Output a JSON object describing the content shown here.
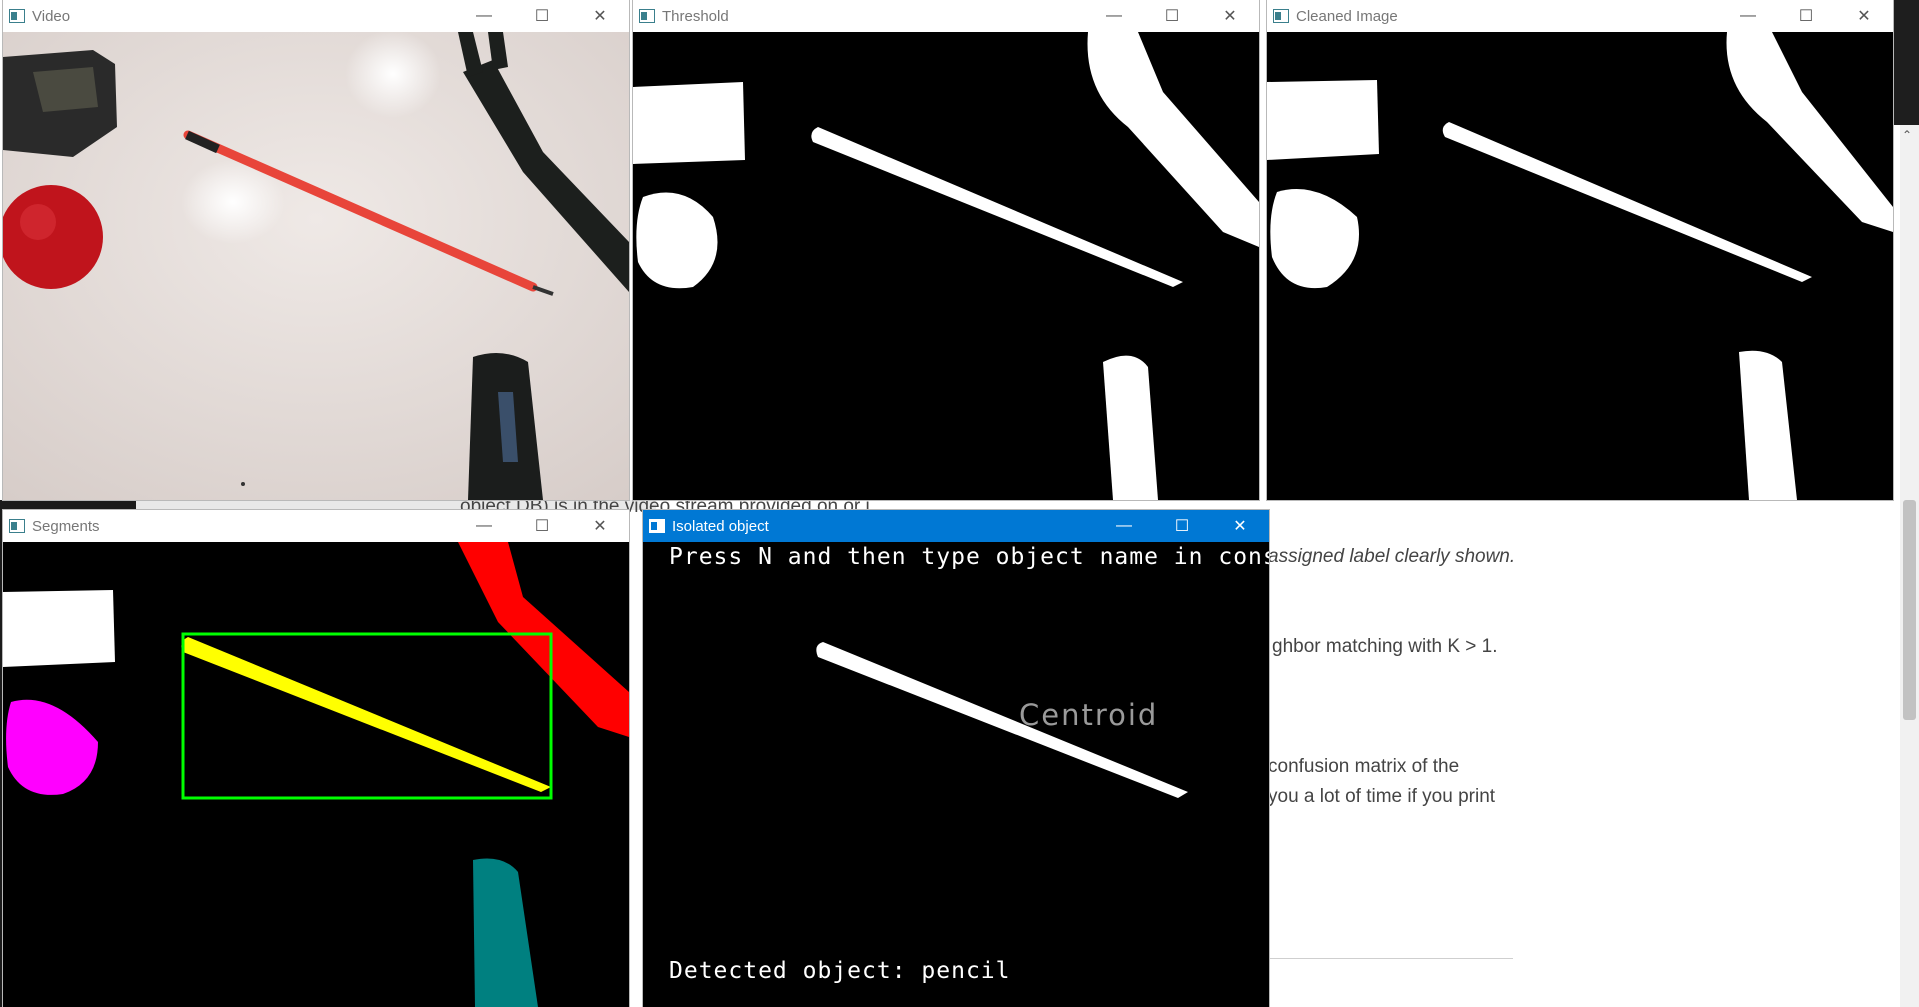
{
  "background_doc": {
    "line1": "assigned label clearly shown.",
    "line2": "ghbor matching with K > 1.",
    "line3": "confusion matrix of the",
    "line4": "you a lot of time if you print",
    "partial": "object DB) is in the video stream provided on or i..."
  },
  "windows": {
    "video": {
      "title": "Video"
    },
    "threshold": {
      "title": "Threshold"
    },
    "cleaned": {
      "title": "Cleaned Image"
    },
    "segments": {
      "title": "Segments"
    },
    "isolated": {
      "title": "Isolated object",
      "instruction": "Press N and then type object name in console",
      "centroid_label": "Centroid",
      "detected": "Detected object: pencil"
    }
  },
  "window_controls": {
    "minimize": "—",
    "maximize": "☐",
    "close": "✕"
  },
  "colors": {
    "active_titlebar": "#0078d4",
    "segment_pencil": "#ffff00",
    "segment_fork": "#ff0000",
    "segment_ball": "#ff00ff",
    "segment_marker": "#008080",
    "bounding_box": "#00ff00"
  }
}
